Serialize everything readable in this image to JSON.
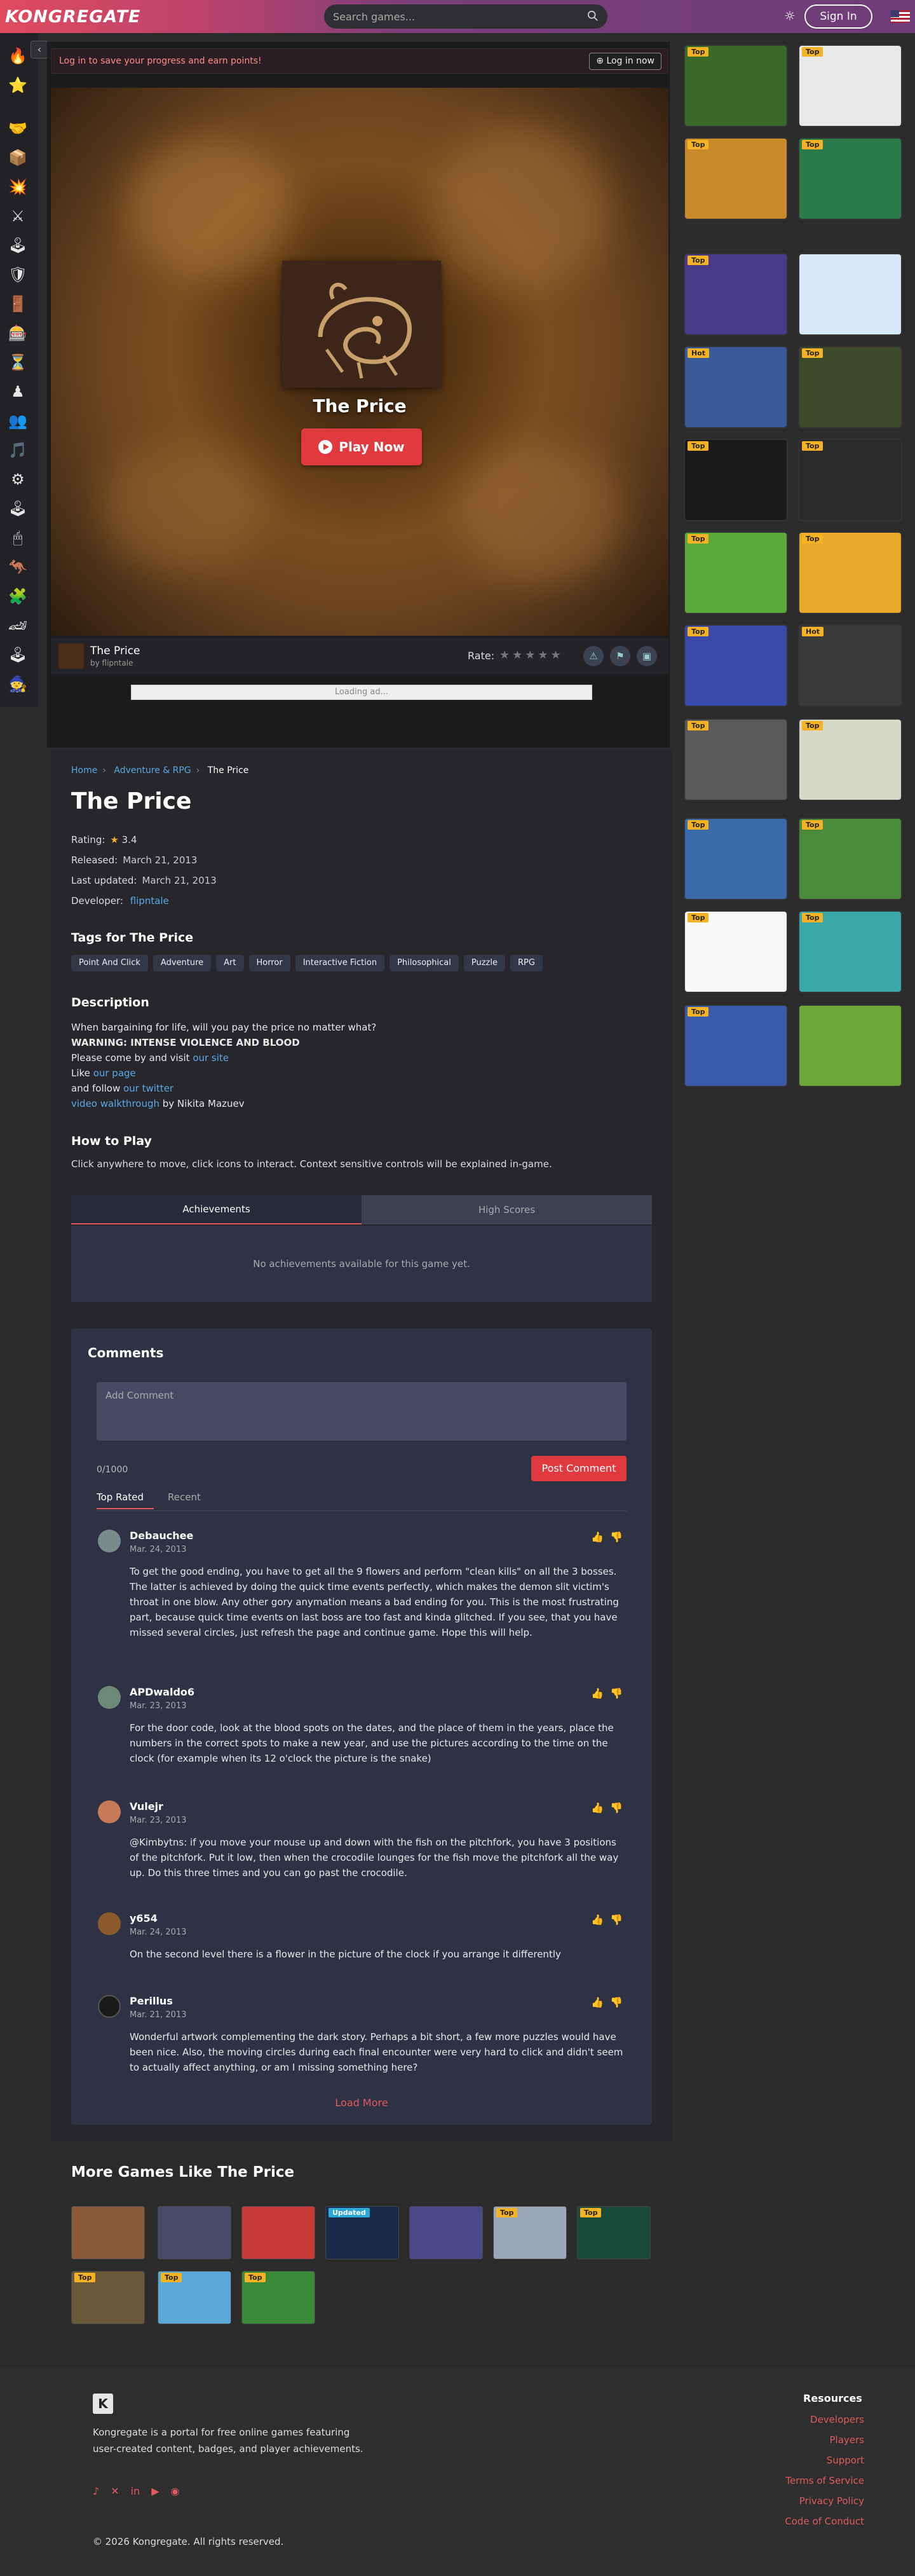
{
  "header": {
    "logo": "KONGREGATE",
    "search_placeholder": "Search games...",
    "signin_label": "Sign In"
  },
  "login_bar": {
    "message": "Log in to save your progress and earn points!",
    "button": "Log in now"
  },
  "game": {
    "title": "The Price",
    "play_label": "Play Now",
    "author": "by flipntale",
    "rate_label": "Rate:",
    "ad_text": "Loading ad..."
  },
  "breadcrumb": [
    "Home",
    "Adventure & RPG",
    "The Price"
  ],
  "details": {
    "title": "The Price",
    "rating_label": "Rating:",
    "rating_value": "3.4",
    "released_label": "Released:",
    "released": "March 21, 2013",
    "updated_label": "Last updated:",
    "updated": "March 21, 2013",
    "developer_label": "Developer:",
    "developer": "flipntale"
  },
  "tags_heading": "Tags for The Price",
  "tags": [
    "Point And Click",
    "Adventure",
    "Art",
    "Horror",
    "Interactive Fiction",
    "Philosophical",
    "Puzzle",
    "RPG"
  ],
  "description_heading": "Description",
  "description": {
    "line1": "When bargaining for life, will you pay the price no matter what?",
    "warning": "WARNING: INTENSE VIOLENCE AND BLOOD",
    "visit": "Please come by and visit ",
    "visit_link": "our site",
    "like": "Like ",
    "like_link": "our page",
    "follow": "and follow ",
    "follow_link": "our twitter",
    "walkthrough_link": "video walkthrough",
    "walkthrough_by": " by Nikita Mazuev"
  },
  "howto_heading": "How to Play",
  "howto_text": "Click anywhere to move, click icons to interact. Context sensitive controls will be explained in-game.",
  "tabs": [
    "Achievements",
    "High Scores"
  ],
  "achievements_empty": "No achievements available for this game yet.",
  "comments": {
    "heading": "Comments",
    "placeholder": "Add Comment",
    "count": "0/1000",
    "post_label": "Post Comment",
    "tabs": [
      "Top Rated",
      "Recent"
    ],
    "items": [
      {
        "name": "Debauchee",
        "date": "Mar. 24, 2013",
        "text": "To get the good ending, you have to get all the 9 flowers and perform \"clean kills\" on all the 3 bosses. The latter is achieved by doing the quick time events perfectly, which makes the demon slit victim's throat in one blow. Any other gory anymation means a bad ending for you. This is the most frustrating part, because quick time events on last boss are too fast and kinda glitched. If you see, that you have missed several circles, just refresh the page and continue game. Hope this will help."
      },
      {
        "name": "APDwaldo6",
        "date": "Mar. 23, 2013",
        "text": "For the door code, look at the blood spots on the dates, and the place of them in the years, place the numbers in the correct spots to make a new year, and use the pictures according to the time on the clock (for example when its 12 o'clock the picture is the snake)"
      },
      {
        "name": "Vulejr",
        "date": "Mar. 23, 2013",
        "text": "@Kimbytns: if you move your mouse up and down with the fish on the pitchfork, you have 3 positions of the pitchfork. Put it low, then when the crocodile lounges for the fish move the pitchfork all the way up. Do this three times and you can go past the crocodile."
      },
      {
        "name": "y654",
        "date": "Mar. 24, 2013",
        "text": "On the second level there is a flower in the picture of the clock if you arrange it differently"
      },
      {
        "name": "Perillus",
        "date": "Mar. 21, 2013",
        "text": "Wonderful artwork complementing the dark story. Perhaps a bit short, a few more puzzles would have been nice. Also, the moving circles during each final encounter were very hard to click and didn't seem to actually affect anything, or am I missing something here?"
      }
    ],
    "load_more": "Load More"
  },
  "more_heading": "More Games Like The Price",
  "more_badges": [
    "",
    "",
    "",
    "Updated",
    "",
    "Top",
    "Top",
    "Top",
    "Top",
    "Top"
  ],
  "side_badges": [
    "Top",
    "Top",
    "Top",
    "Top",
    "Top",
    "",
    "Hot",
    "Top",
    "Top",
    "Top",
    "Top",
    "Top",
    "Top",
    "Hot",
    "Top",
    "Top",
    "Top",
    "Top",
    "Top",
    "Top",
    "Top",
    ""
  ],
  "footer": {
    "logo": "K",
    "description": "Kongregate is a portal for free online games featuring user-created content, badges, and player achievements.",
    "copyright": "© 2026 Kongregate. All rights reserved.",
    "resources_heading": "Resources",
    "links": [
      "Developers",
      "Players",
      "Support",
      "Terms of Service",
      "Privacy Policy",
      "Code of Conduct"
    ]
  },
  "colors": {
    "accent": "#e03a3e",
    "link": "#5aa9e6",
    "badge": "#f5b323"
  }
}
